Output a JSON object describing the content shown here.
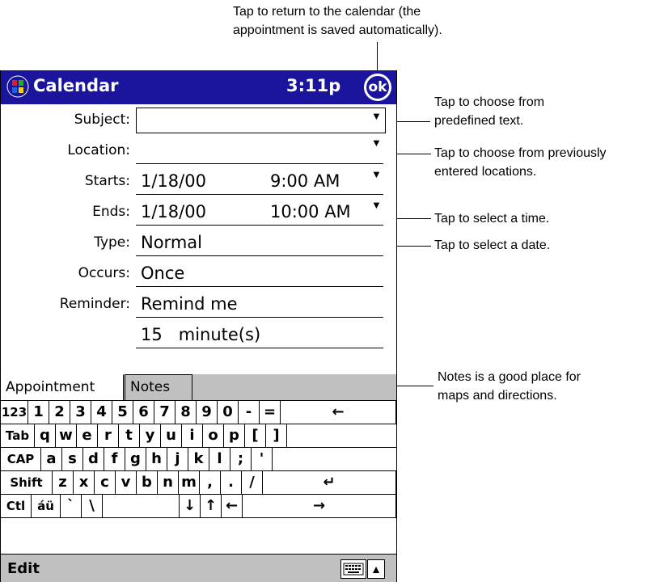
{
  "callouts": {
    "top": [
      "Tap to return to the calendar (the",
      "appointment is saved automatically)."
    ],
    "predefined": [
      "Tap to choose from",
      "predefined text."
    ],
    "locations": [
      "Tap to choose from previously",
      "entered locations."
    ],
    "time": "Tap to select a time.",
    "date": "Tap to select a date.",
    "notes": [
      "Notes is a good place for",
      "maps and directions."
    ]
  },
  "titlebar": {
    "title": "Calendar",
    "time": "3:11p",
    "ok": "ok"
  },
  "form": {
    "subject": {
      "label": "Subject:",
      "value": ""
    },
    "location": {
      "label": "Location:",
      "value": ""
    },
    "starts": {
      "label": "Starts:",
      "date": "1/18/00",
      "time": "9:00 AM"
    },
    "ends": {
      "label": "Ends:",
      "date": "1/18/00",
      "time": "10:00 AM"
    },
    "type": {
      "label": "Type:",
      "value": "Normal"
    },
    "occurs": {
      "label": "Occurs:",
      "value": "Once"
    },
    "reminder": {
      "label": "Reminder:",
      "value": "Remind me",
      "value2": "15   minute(s)"
    }
  },
  "tabs": {
    "appointment": "Appointment",
    "notes": "Notes"
  },
  "keyboard": {
    "rows": [
      [
        "123",
        "1",
        "2",
        "3",
        "4",
        "5",
        "6",
        "7",
        "8",
        "9",
        "0",
        "-",
        "=",
        "←"
      ],
      [
        "Tab",
        "q",
        "w",
        "e",
        "r",
        "t",
        "y",
        "u",
        "i",
        "o",
        "p",
        "[",
        "]"
      ],
      [
        "CAP",
        "a",
        "s",
        "d",
        "f",
        "g",
        "h",
        "j",
        "k",
        "l",
        ";",
        "'"
      ],
      [
        "Shift",
        "z",
        "x",
        "c",
        "v",
        "b",
        "n",
        "m",
        ",",
        ".",
        "/",
        "↵"
      ],
      [
        "Ctl",
        "áü",
        "`",
        "\\",
        " ",
        "↓",
        "↑",
        "←",
        "→"
      ]
    ]
  },
  "cmdbar": {
    "edit": "Edit"
  },
  "colors": {
    "titlebar": "#1b149c",
    "bar": "#c0c0c0"
  }
}
